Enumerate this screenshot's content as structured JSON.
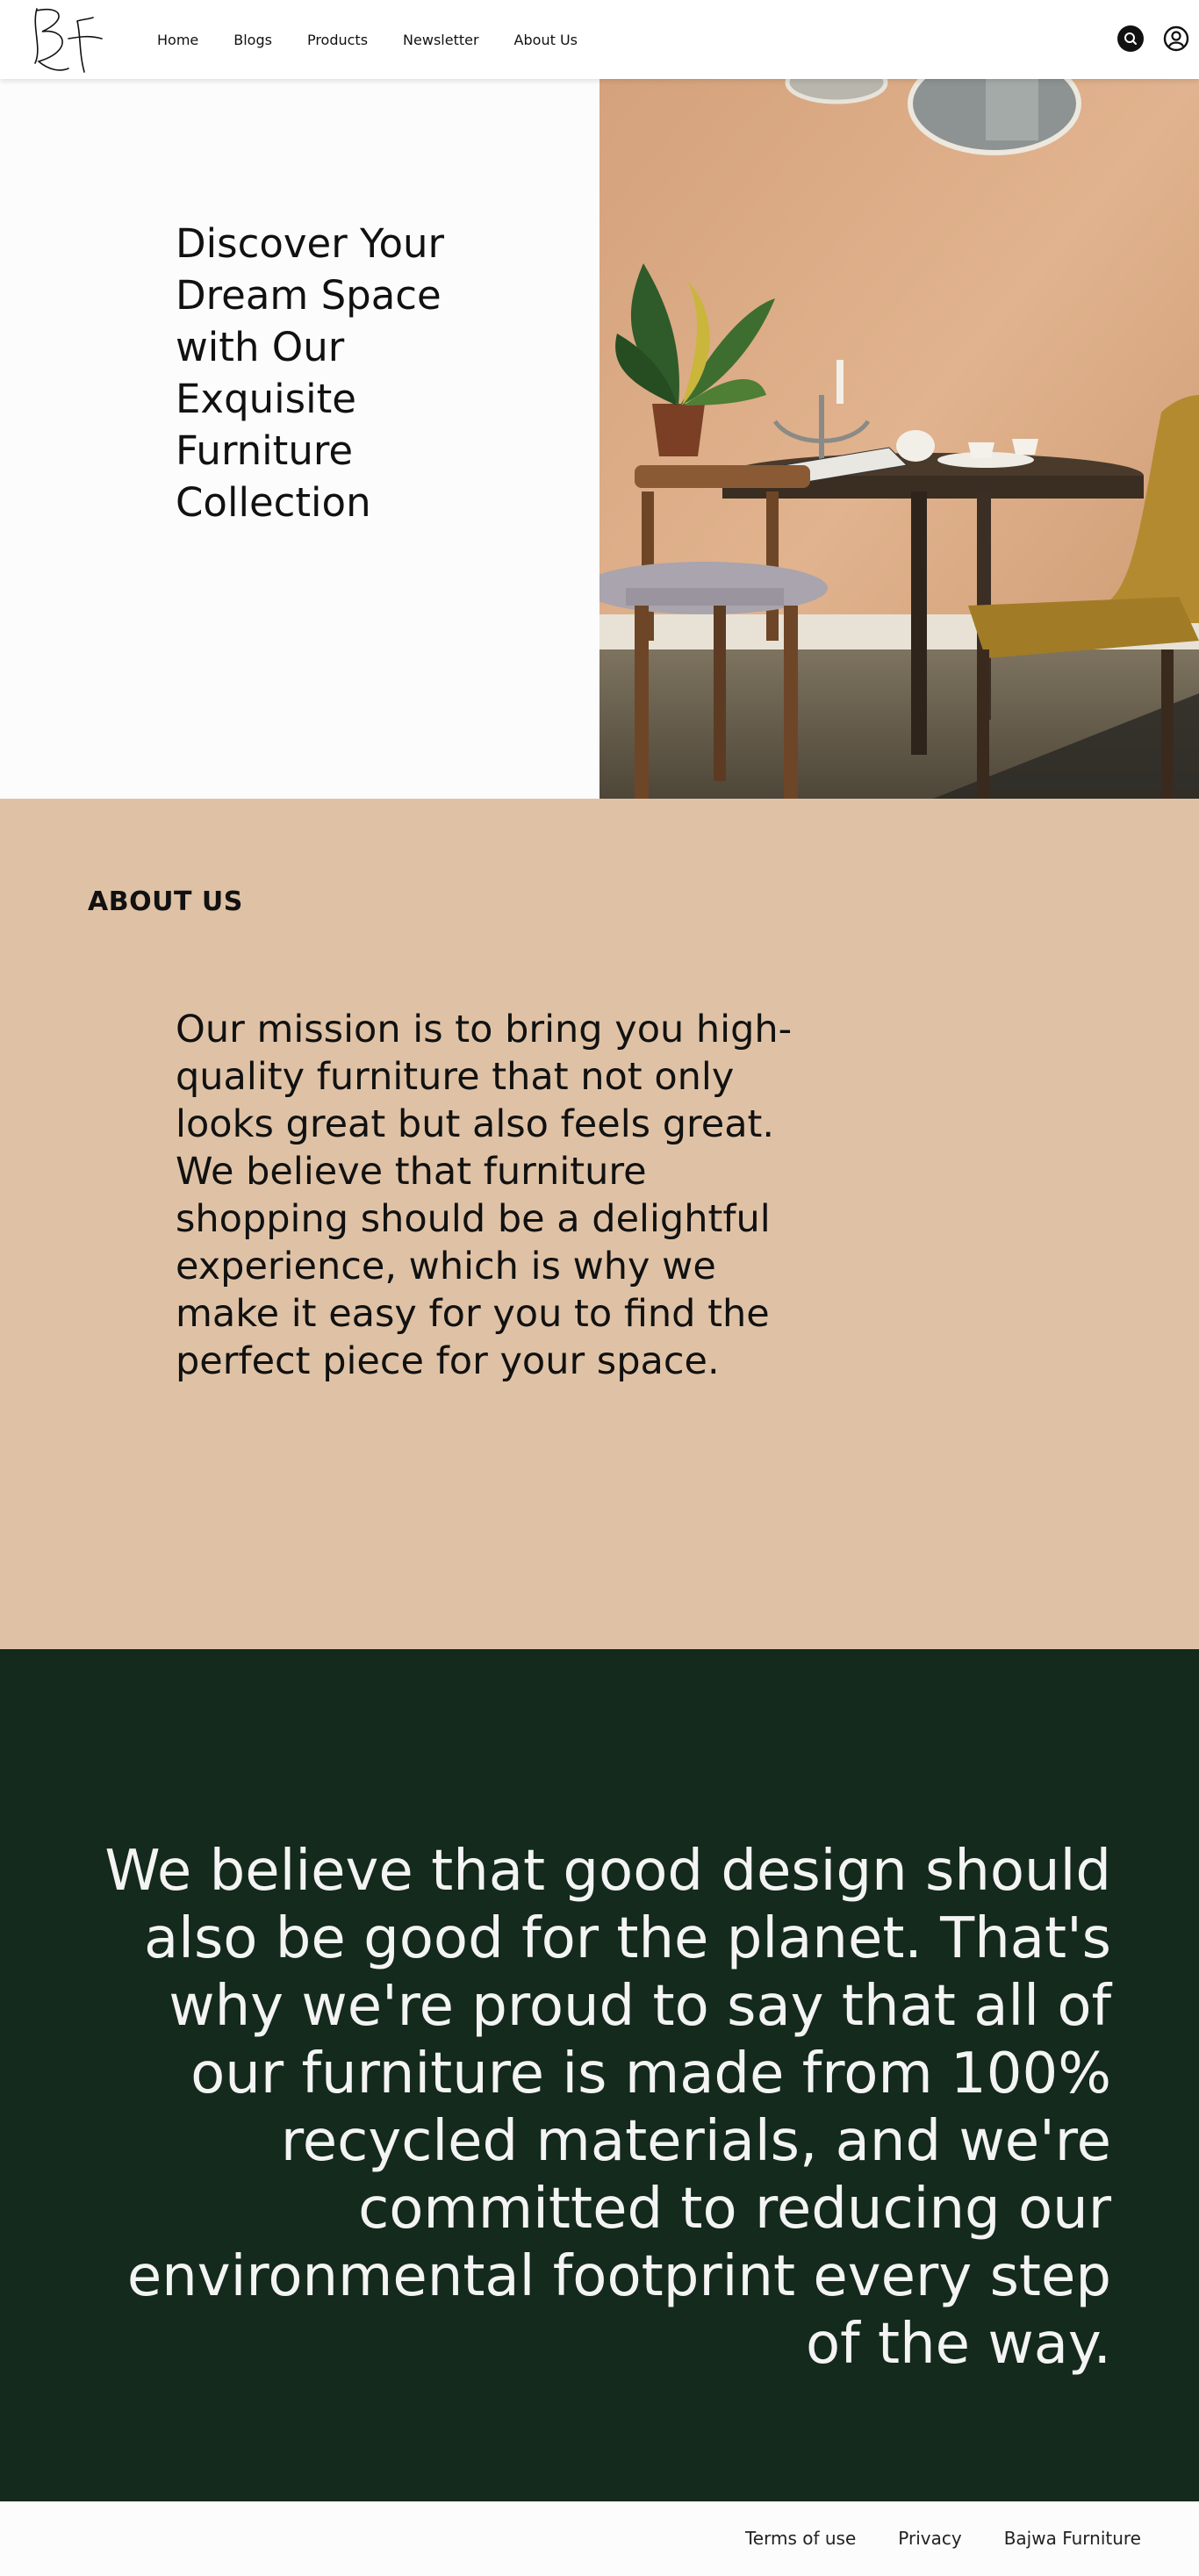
{
  "nav": {
    "logo_text": "BF",
    "links": [
      "Home",
      "Blogs",
      "Products",
      "Newsletter",
      "About Us"
    ],
    "icons": [
      "search-icon",
      "user-icon"
    ]
  },
  "hero": {
    "title": "Discover Your Dream Space with Our Exquisite Furniture Collection",
    "image": "dining-corner-photo"
  },
  "about": {
    "heading": "ABOUT US",
    "text": "Our mission is to bring you high-quality furniture that not only looks great but also feels great. We believe that furniture shopping should be a delightful experience, which is why we make it easy for you to find the perfect piece for your space."
  },
  "sustainability": {
    "text": "We believe that good design should also be good for the planet. That's why we're proud to say that all of our furniture is made from 100% recycled materials, and we're committed to reducing our environmental footprint every step of the way."
  },
  "footer": {
    "links": [
      "Terms of use",
      "Privacy",
      "Bajwa Furniture"
    ]
  },
  "colors": {
    "about_bg": "#dfc2a5",
    "green_bg": "#132a1c",
    "wall": "#d9a882"
  }
}
